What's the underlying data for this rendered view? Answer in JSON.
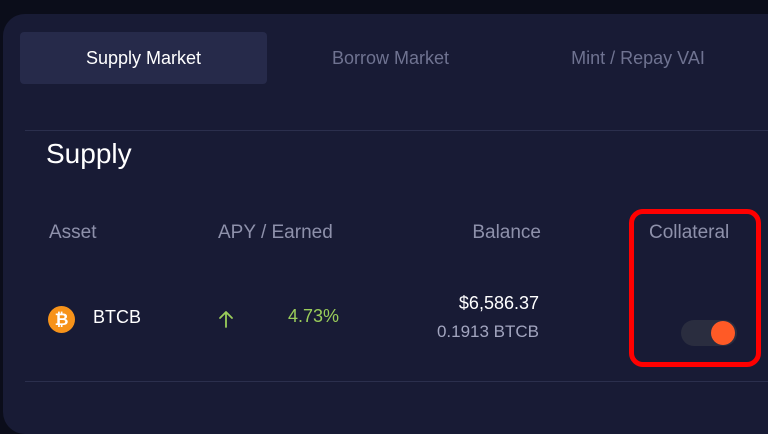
{
  "tabs": [
    {
      "label": "Supply Market",
      "active": true
    },
    {
      "label": "Borrow Market",
      "active": false
    },
    {
      "label": "Mint / Repay VAI",
      "active": false
    }
  ],
  "section": {
    "title": "Supply"
  },
  "columns": {
    "asset": "Asset",
    "apy": "APY / Earned",
    "balance": "Balance",
    "collateral": "Collateral"
  },
  "rows": [
    {
      "asset_icon": "bitcoin-icon",
      "asset_symbol": "₿",
      "asset": "BTCB",
      "apy_direction": "up-arrow-icon",
      "apy": "4.73%",
      "balance_usd": "$6,586.37",
      "balance_token": "0.1913 BTCB",
      "collateral_enabled": true
    }
  ],
  "colors": {
    "panel": "#181b35",
    "active_tab": "#262a4a",
    "apy_green": "#9acd5a",
    "toggle_on": "#ff5a26",
    "bitcoin": "#f7931a",
    "highlight": "#ff0000"
  }
}
